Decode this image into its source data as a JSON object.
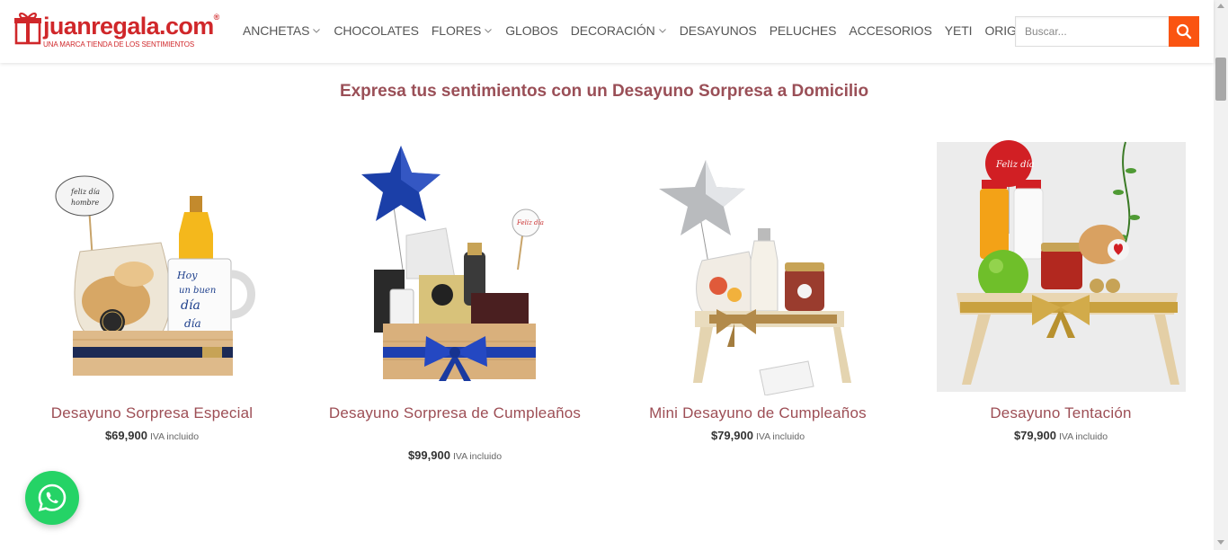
{
  "brand": {
    "name": "juanregala.com",
    "registered": "®",
    "tagline": "UNA MARCA TIENDA DE LOS SENTIMIENTOS",
    "color": "#d0272a"
  },
  "nav": {
    "items": [
      {
        "label": "ANCHETAS",
        "has_dropdown": true
      },
      {
        "label": "CHOCOLATES",
        "has_dropdown": false
      },
      {
        "label": "FLORES",
        "has_dropdown": true
      },
      {
        "label": "GLOBOS",
        "has_dropdown": false
      },
      {
        "label": "DECORACIÓN",
        "has_dropdown": true
      },
      {
        "label": "DESAYUNOS",
        "has_dropdown": false
      },
      {
        "label": "PELUCHES",
        "has_dropdown": false
      },
      {
        "label": "ACCESORIOS",
        "has_dropdown": false
      },
      {
        "label": "YETI",
        "has_dropdown": false
      },
      {
        "label": "ORIGINAL",
        "has_dropdown": true
      }
    ]
  },
  "search": {
    "placeholder": "Buscar...",
    "value": "",
    "button_icon": "search-icon",
    "button_color": "#fa5411"
  },
  "main": {
    "section_title": "Expresa tus sentimientos con un  Desayuno Sorpresa a Domicilio",
    "title_color": "#9a4f57",
    "products": [
      {
        "name": "Desayuno Sorpresa Especial",
        "price": "$69,900",
        "price_suffix": "IVA incluido",
        "image": "breakfast-tray-mug-juice"
      },
      {
        "name": "Desayuno Sorpresa de Cumpleaños",
        "price": "$99,900",
        "price_suffix": "IVA incluido",
        "image": "breakfast-box-blue-balloon"
      },
      {
        "name": "Mini Desayuno de Cumpleaños",
        "price": "$79,900",
        "price_suffix": "IVA incluido",
        "image": "breakfast-tray-silver-balloon"
      },
      {
        "name": "Desayuno Tentación",
        "price": "$79,900",
        "price_suffix": "IVA incluido",
        "image": "breakfast-tray-apple-juice"
      }
    ]
  },
  "whatsapp": {
    "icon": "whatsapp-icon",
    "color": "#25d366"
  }
}
